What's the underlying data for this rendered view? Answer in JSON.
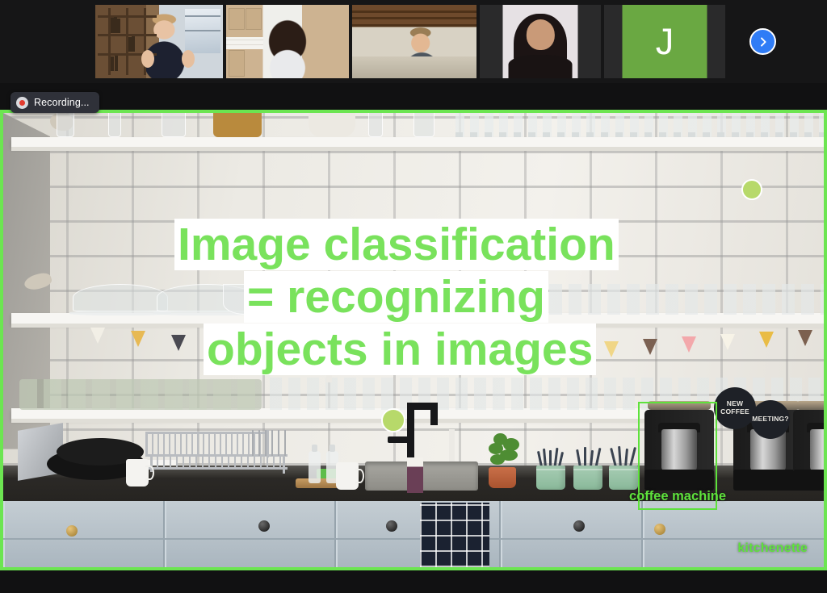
{
  "app": {
    "background_color": "#161617",
    "accent_green": "#6ce551",
    "caption_green": "#79e25c",
    "annotation_green": "#5ee23c"
  },
  "filmstrip": {
    "participants": [
      {
        "name": "participant-1",
        "type": "video",
        "active_speaker": true,
        "initial": ""
      },
      {
        "name": "participant-2",
        "type": "video",
        "active_speaker": false,
        "initial": ""
      },
      {
        "name": "participant-3",
        "type": "video",
        "active_speaker": false,
        "initial": ""
      },
      {
        "name": "participant-4",
        "type": "photo",
        "active_speaker": false,
        "initial": ""
      },
      {
        "name": "participant-5",
        "type": "initial-avatar",
        "active_speaker": false,
        "initial": "J",
        "avatar_color": "#6aa842"
      }
    ],
    "next_page_button": {
      "icon": "chevron-right-icon",
      "color": "#2f7cf6"
    }
  },
  "recording_badge": {
    "label": "Recording...",
    "dot_color": "#e23b2e",
    "background": "#2f3139"
  },
  "shared_screen": {
    "border_color": "#6ce551",
    "caption": {
      "line1": "Image classification",
      "line2": "= recognizing",
      "line3": "objects in images"
    },
    "annotations": {
      "bounding_box_label": "coffee machine",
      "scene_label": "kitchenette"
    },
    "signs": {
      "new_coffee": "NEW COFFEE",
      "meeting": "MEETING?"
    }
  }
}
